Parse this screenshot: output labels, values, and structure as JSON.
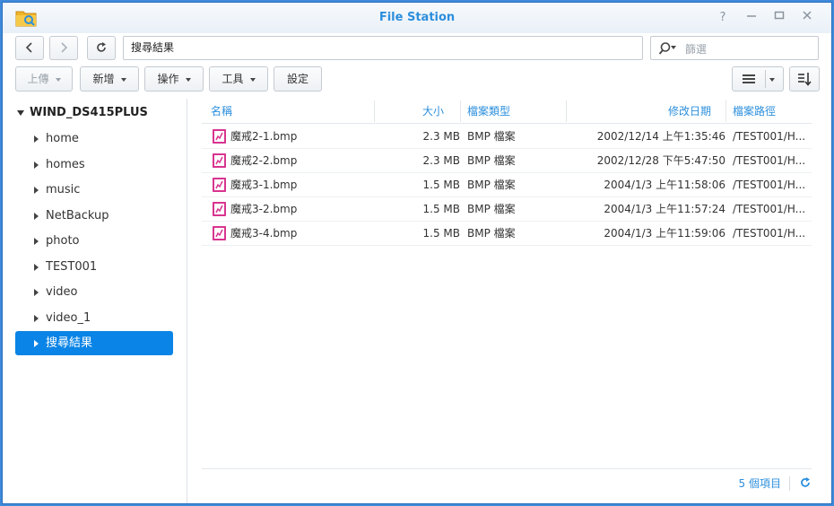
{
  "window": {
    "title": "File Station"
  },
  "nav": {
    "path": "搜尋結果",
    "search_placeholder": "篩選"
  },
  "toolbar": {
    "upload": "上傳",
    "new": "新增",
    "action": "操作",
    "tools": "工具",
    "settings": "設定"
  },
  "sidebar": {
    "root": "WIND_DS415PLUS",
    "items": [
      {
        "label": "home"
      },
      {
        "label": "homes"
      },
      {
        "label": "music"
      },
      {
        "label": "NetBackup"
      },
      {
        "label": "photo"
      },
      {
        "label": "TEST001"
      },
      {
        "label": "video"
      },
      {
        "label": "video_1"
      },
      {
        "label": "搜尋結果"
      }
    ],
    "selected_index": 8
  },
  "columns": {
    "name": "名稱",
    "size": "大小",
    "type": "檔案類型",
    "modified": "修改日期",
    "path": "檔案路徑"
  },
  "files": [
    {
      "name": "魔戒2-1.bmp",
      "size": "2.3 MB",
      "type": "BMP 檔案",
      "modified": "2002/12/14 上午1:35:46",
      "path": "/TEST001/H..."
    },
    {
      "name": "魔戒2-2.bmp",
      "size": "2.3 MB",
      "type": "BMP 檔案",
      "modified": "2002/12/28 下午5:47:50",
      "path": "/TEST001/H..."
    },
    {
      "name": "魔戒3-1.bmp",
      "size": "1.5 MB",
      "type": "BMP 檔案",
      "modified": "2004/1/3 上午11:58:06",
      "path": "/TEST001/H..."
    },
    {
      "name": "魔戒3-2.bmp",
      "size": "1.5 MB",
      "type": "BMP 檔案",
      "modified": "2004/1/3 上午11:57:24",
      "path": "/TEST001/H..."
    },
    {
      "name": "魔戒3-4.bmp",
      "size": "1.5 MB",
      "type": "BMP 檔案",
      "modified": "2004/1/3 上午11:59:06",
      "path": "/TEST001/H..."
    }
  ],
  "status": {
    "item_count": "5 個項目"
  },
  "icons": {
    "app": "file-station-folder-icon",
    "file": "image-file-icon",
    "search": "search-icon",
    "refresh": "refresh-icon"
  },
  "colors": {
    "accent": "#2d8fdc",
    "selected": "#0a84e6",
    "file_icon": "#d8348f"
  }
}
